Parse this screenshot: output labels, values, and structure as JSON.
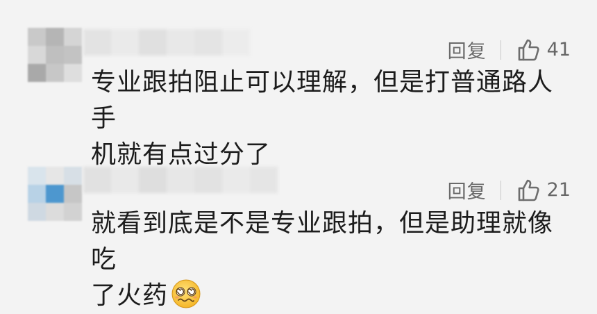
{
  "comments": [
    {
      "reply_label": "回复",
      "like_count": "41",
      "text_line1": "专业跟拍阻止可以理解，但是打普通路人手",
      "text_line2": "机就有点过分了"
    },
    {
      "reply_label": "回复",
      "like_count": "21",
      "text_line1": "就看到底是不是专业跟拍，但是助理就像吃",
      "text_line2": "了火药",
      "emoji": "woozy-face-emoji"
    }
  ],
  "colors": {
    "background": "#f3f3f3",
    "text": "#1c1c1c",
    "meta": "#6d6d6d"
  }
}
